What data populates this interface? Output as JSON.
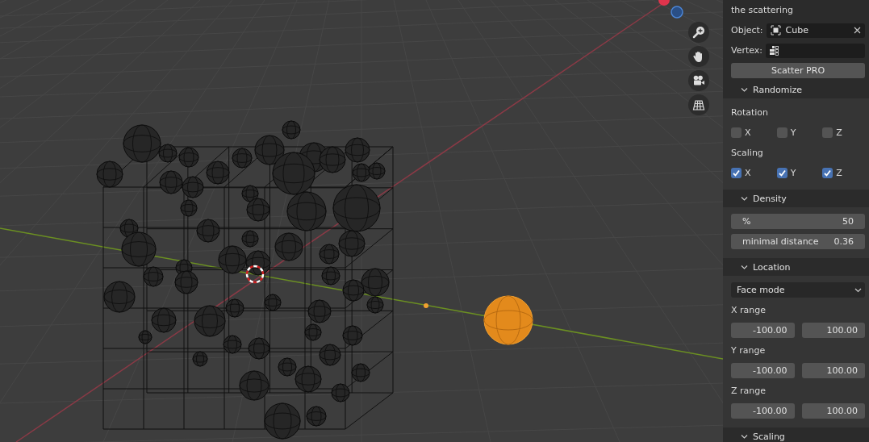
{
  "panel": {
    "title": "the scattering",
    "object_field": {
      "label": "Object:",
      "value": "Cube"
    },
    "vertex_field": {
      "label": "Vertex:"
    },
    "scatter_button": "Scatter PRO",
    "sections": [
      {
        "title": "Randomize",
        "expanded": true,
        "rows": [
          {
            "kind": "label",
            "text": "Rotation"
          },
          {
            "kind": "checks",
            "items": [
              {
                "label": "X",
                "checked": false
              },
              {
                "label": "Y",
                "checked": false
              },
              {
                "label": "Z",
                "checked": false
              }
            ]
          },
          {
            "kind": "label",
            "text": "Scaling"
          },
          {
            "kind": "checks",
            "items": [
              {
                "label": "X",
                "checked": true
              },
              {
                "label": "Y",
                "checked": true
              },
              {
                "label": "Z",
                "checked": true
              }
            ]
          }
        ]
      },
      {
        "title": "Density",
        "expanded": true,
        "rows": [
          {
            "kind": "slider",
            "label": "%",
            "value": "50"
          },
          {
            "kind": "slider",
            "label": "minimal distance",
            "value": "0.36"
          }
        ]
      },
      {
        "title": "Location",
        "expanded": true,
        "rows": [
          {
            "kind": "dropdown",
            "value": "Face mode"
          },
          {
            "kind": "label",
            "text": "X range"
          },
          {
            "kind": "pair",
            "values": [
              "-100.00",
              "100.00"
            ]
          },
          {
            "kind": "label",
            "text": "Y range"
          },
          {
            "kind": "pair",
            "values": [
              "-100.00",
              "100.00"
            ]
          },
          {
            "kind": "label",
            "text": "Z range"
          },
          {
            "kind": "pair",
            "values": [
              "-100.00",
              "100.00"
            ]
          }
        ]
      },
      {
        "title": "Scaling",
        "expanded": true
      }
    ]
  }
}
